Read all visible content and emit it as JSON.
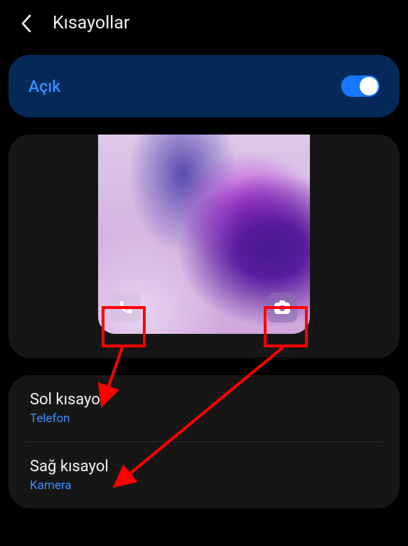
{
  "header": {
    "title": "Kısayollar"
  },
  "toggle": {
    "label": "Açık",
    "state": "on"
  },
  "shortcuts": {
    "left": {
      "title": "Sol kısayol",
      "value": "Telefon"
    },
    "right": {
      "title": "Sağ kısayol",
      "value": "Kamera"
    }
  },
  "icons": {
    "back": "chevron-left",
    "phone": "phone-icon",
    "camera": "camera-icon"
  },
  "colors": {
    "accent": "#3a8fff",
    "switch_on": "#1877ff",
    "annotation": "#ff0000"
  }
}
